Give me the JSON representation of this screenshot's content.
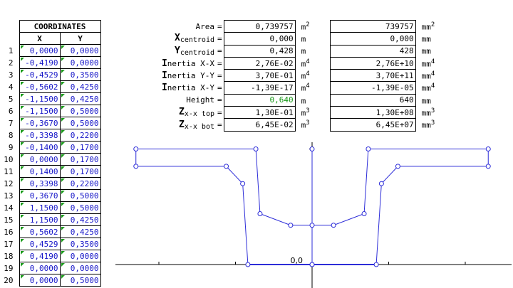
{
  "coordinates": {
    "title": "COORDINATES",
    "col_x": "X",
    "col_y": "Y",
    "rows": [
      {
        "n": "1",
        "x": "0,0000",
        "y": "0,0000"
      },
      {
        "n": "2",
        "x": "-0,4190",
        "y": "0,0000"
      },
      {
        "n": "3",
        "x": "-0,4529",
        "y": "0,3500"
      },
      {
        "n": "4",
        "x": "-0,5602",
        "y": "0,4250"
      },
      {
        "n": "5",
        "x": "-1,1500",
        "y": "0,4250"
      },
      {
        "n": "6",
        "x": "-1,1500",
        "y": "0,5000"
      },
      {
        "n": "7",
        "x": "-0,3670",
        "y": "0,5000"
      },
      {
        "n": "8",
        "x": "-0,3398",
        "y": "0,2200"
      },
      {
        "n": "9",
        "x": "-0,1400",
        "y": "0,1700"
      },
      {
        "n": "10",
        "x": "0,0000",
        "y": "0,1700"
      },
      {
        "n": "11",
        "x": "0,1400",
        "y": "0,1700"
      },
      {
        "n": "12",
        "x": "0,3398",
        "y": "0,2200"
      },
      {
        "n": "13",
        "x": "0,3670",
        "y": "0,5000"
      },
      {
        "n": "14",
        "x": "1,1500",
        "y": "0,5000"
      },
      {
        "n": "15",
        "x": "1,1500",
        "y": "0,4250"
      },
      {
        "n": "16",
        "x": "0,5602",
        "y": "0,4250"
      },
      {
        "n": "17",
        "x": "0,4529",
        "y": "0,3500"
      },
      {
        "n": "18",
        "x": "0,4190",
        "y": "0,0000"
      },
      {
        "n": "19",
        "x": "0,0000",
        "y": "0,0000"
      },
      {
        "n": "20",
        "x": "0,0000",
        "y": "0,5000"
      }
    ]
  },
  "properties": [
    {
      "label": "Area",
      "sub": "",
      "eq": "=",
      "v1": "0,739757",
      "u1": "m",
      "p1": "2",
      "v2": "739757",
      "u2": "mm",
      "p2": "2",
      "green": false
    },
    {
      "label": "X",
      "sub": "centroid",
      "eq": "=",
      "v1": "0,000",
      "u1": "m",
      "p1": "",
      "v2": "0,000",
      "u2": "mm",
      "p2": "",
      "green": false
    },
    {
      "label": "Y",
      "sub": "centroid",
      "eq": "=",
      "v1": "0,428",
      "u1": "m",
      "p1": "",
      "v2": "428",
      "u2": "mm",
      "p2": "",
      "green": false
    },
    {
      "label": "I",
      "sub": "nertia X-X",
      "eq": "=",
      "v1": "2,76E-02",
      "u1": "m",
      "p1": "4",
      "v2": "2,76E+10",
      "u2": "mm",
      "p2": "4",
      "green": false
    },
    {
      "label": "I",
      "sub": "nertia Y-Y",
      "eq": "=",
      "v1": "3,70E-01",
      "u1": "m",
      "p1": "4",
      "v2": "3,70E+11",
      "u2": "mm",
      "p2": "4",
      "green": false
    },
    {
      "label": "I",
      "sub": "nertia X-Y",
      "eq": "=",
      "v1": "-1,39E-17",
      "u1": "m",
      "p1": "4",
      "v2": "-1,39E-05",
      "u2": "mm",
      "p2": "4",
      "green": false
    },
    {
      "label": "Height",
      "sub": "",
      "eq": "=",
      "v1": "0,640",
      "u1": "m",
      "p1": "",
      "v2": "640",
      "u2": "mm",
      "p2": "",
      "green": true
    },
    {
      "label": "Z",
      "sub": "x-x top",
      "eq": "=",
      "v1": "1,30E-01",
      "u1": "m",
      "p1": "3",
      "v2": "1,30E+08",
      "u2": "mm",
      "p2": "3",
      "green": false
    },
    {
      "label": "Z",
      "sub": "x-x bot",
      "eq": "=",
      "v1": "6,45E-02",
      "u1": "m",
      "p1": "3",
      "v2": "6,45E+07",
      "u2": "mm",
      "p2": "3",
      "green": false
    }
  ],
  "chart_data": {
    "type": "line",
    "y_tick_top": "1,0",
    "origin_label": "0,0",
    "line_color": "#2d2dd8",
    "series": [
      {
        "points": [
          [
            0,
            0
          ],
          [
            -0.419,
            0
          ],
          [
            -0.4529,
            0.35
          ],
          [
            -0.5602,
            0.425
          ],
          [
            -1.15,
            0.425
          ],
          [
            -1.15,
            0.5
          ],
          [
            -0.367,
            0.5
          ],
          [
            -0.3398,
            0.22
          ],
          [
            -0.14,
            0.17
          ],
          [
            0,
            0.17
          ],
          [
            0.14,
            0.17
          ],
          [
            0.3398,
            0.22
          ],
          [
            0.367,
            0.5
          ],
          [
            1.15,
            0.5
          ],
          [
            1.15,
            0.425
          ],
          [
            0.5602,
            0.425
          ],
          [
            0.4529,
            0.35
          ],
          [
            0.419,
            0
          ],
          [
            0,
            0
          ],
          [
            0,
            0.5
          ]
        ]
      }
    ]
  }
}
